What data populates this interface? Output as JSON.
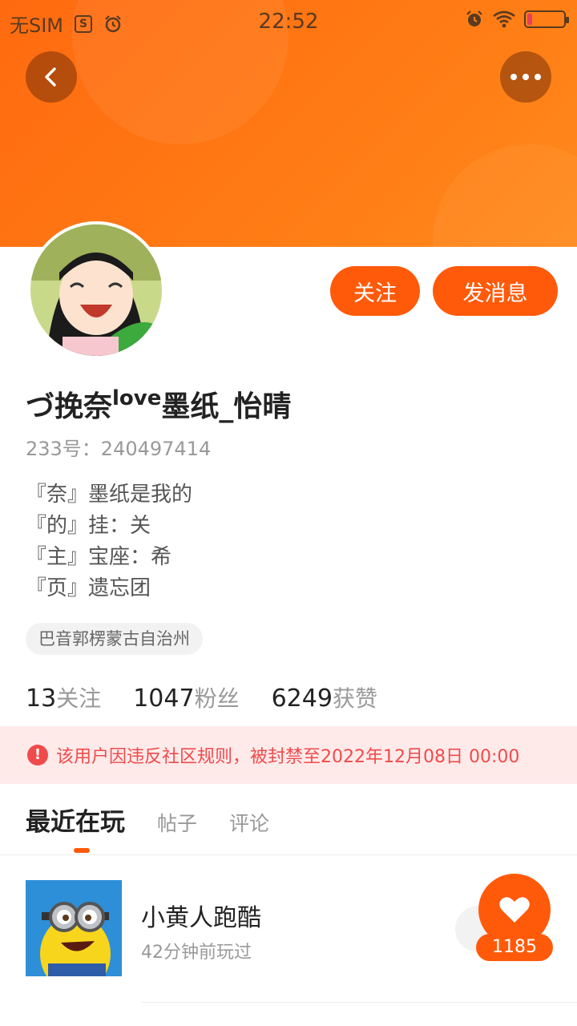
{
  "status_bar": {
    "carrier": "无SIM",
    "time": "22:52"
  },
  "header": {
    "back_icon": "chevron-left-icon",
    "more_icon": "more-dots-icon",
    "banner_color": "#ff7a14"
  },
  "profile": {
    "follow_label": "关注",
    "message_label": "发消息",
    "name_prefix": "づ挽奈",
    "name_sup": "love",
    "name_suffix": "墨纸_怡晴",
    "user_id": "233号：240497414",
    "bio": [
      "『奈』墨纸是我的",
      "『的』挂：关",
      "『主』宝座：希",
      "『页』遗忘团"
    ],
    "region": "巴音郭楞蒙古自治州"
  },
  "stats": [
    {
      "value": "13",
      "label": "关注"
    },
    {
      "value": "1047",
      "label": "粉丝"
    },
    {
      "value": "6249",
      "label": "获赞"
    }
  ],
  "ban_notice": {
    "icon": "!",
    "text": "该用户因违反社区规则，被封禁至2022年12月08日 00:00",
    "color": "#f04b4b"
  },
  "tabs": [
    "最近在玩",
    "帖子",
    "评论"
  ],
  "games": [
    {
      "title": "小黄人跑酷",
      "subtitle": "42分钟前玩过"
    }
  ],
  "like": {
    "count": "1185",
    "accent": "#ff5a0a"
  }
}
